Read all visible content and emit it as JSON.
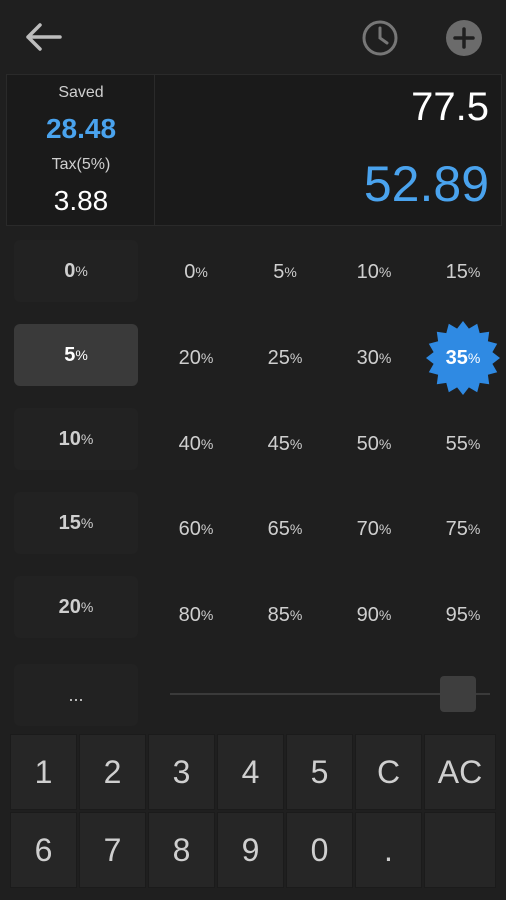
{
  "display": {
    "saved_label": "Saved",
    "saved_value": "28.48",
    "tax_label": "Tax(5%)",
    "tax_value": "3.88",
    "amount": "77.5",
    "total": "52.89"
  },
  "tax_rates": [
    {
      "num": "0",
      "unit": "%"
    },
    {
      "num": "5",
      "unit": "%"
    },
    {
      "num": "10",
      "unit": "%"
    },
    {
      "num": "15",
      "unit": "%"
    },
    {
      "num": "20",
      "unit": "%"
    }
  ],
  "tip_rates": [
    {
      "num": "0",
      "unit": "%"
    },
    {
      "num": "5",
      "unit": "%"
    },
    {
      "num": "10",
      "unit": "%"
    },
    {
      "num": "15",
      "unit": "%"
    },
    {
      "num": "20",
      "unit": "%"
    },
    {
      "num": "25",
      "unit": "%"
    },
    {
      "num": "30",
      "unit": "%"
    },
    {
      "num": "35",
      "unit": "%"
    },
    {
      "num": "40",
      "unit": "%"
    },
    {
      "num": "45",
      "unit": "%"
    },
    {
      "num": "50",
      "unit": "%"
    },
    {
      "num": "55",
      "unit": "%"
    },
    {
      "num": "60",
      "unit": "%"
    },
    {
      "num": "65",
      "unit": "%"
    },
    {
      "num": "70",
      "unit": "%"
    },
    {
      "num": "75",
      "unit": "%"
    },
    {
      "num": "80",
      "unit": "%"
    },
    {
      "num": "85",
      "unit": "%"
    },
    {
      "num": "90",
      "unit": "%"
    },
    {
      "num": "95",
      "unit": "%"
    }
  ],
  "more_label": "...",
  "slider": {
    "value_fraction": 0.9
  },
  "keys": [
    {
      "label": "1"
    },
    {
      "label": "2"
    },
    {
      "label": "3"
    },
    {
      "label": "4"
    },
    {
      "label": "5"
    },
    {
      "label": "C"
    },
    {
      "label": "AC"
    },
    {
      "label": "6"
    },
    {
      "label": "7"
    },
    {
      "label": "8"
    },
    {
      "label": "9"
    },
    {
      "label": "0"
    },
    {
      "label": "."
    },
    {
      "label": ""
    }
  ],
  "icons": {
    "back": "back-arrow-icon",
    "history": "clock-icon",
    "add": "plus-circle-icon"
  },
  "colors": {
    "accent": "#4aa3ee",
    "background": "#1f1f1f"
  }
}
